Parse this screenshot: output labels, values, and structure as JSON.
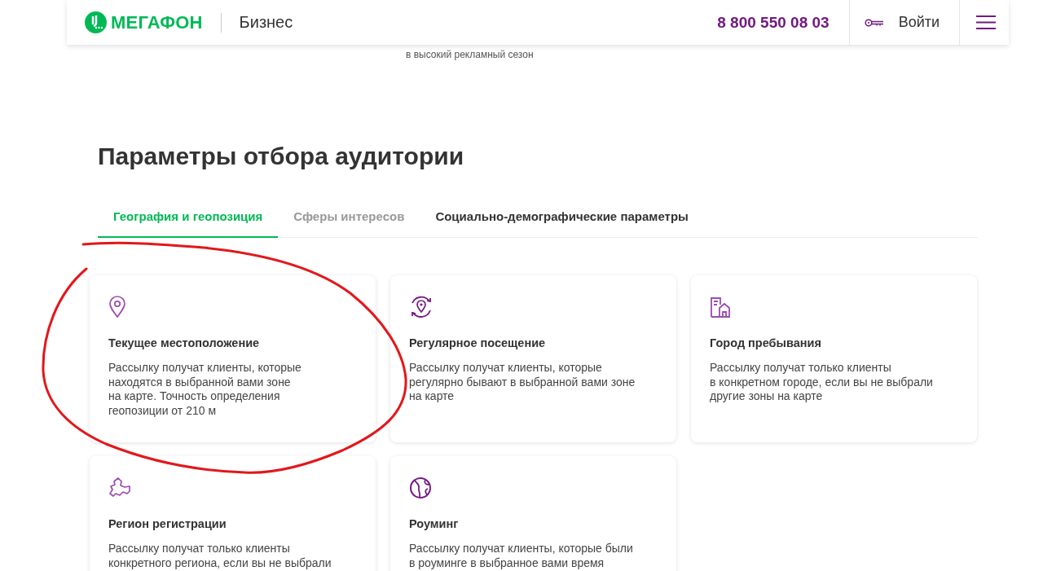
{
  "header": {
    "logo": "МЕГАФОН",
    "section": "Бизнес",
    "phone": "8 800 550 08 03",
    "login": "Войти"
  },
  "partial_text": "в высокий рекламный сезон",
  "title": "Параметры отбора аудитории",
  "tabs": [
    {
      "label": "География и геопозиция",
      "selected": true,
      "dimmed": false
    },
    {
      "label": "Сферы интересов",
      "selected": false,
      "dimmed": true
    },
    {
      "label": "Социально-демографические параметры",
      "selected": false,
      "dimmed": false
    }
  ],
  "cards": [
    {
      "kind": "pin",
      "title": "Текущее местоположение",
      "text": "Рассылку получат клиенты, которые\nнаходятся в выбранной вами зоне\nна карте. Точность определения\nгеопозиции от 210 м"
    },
    {
      "kind": "rotate-pin",
      "title": "Регулярное посещение",
      "text": "Рассылку получат клиенты, которые\nрегулярно бывают в выбранной вами зоне\nна карте"
    },
    {
      "kind": "building",
      "title": "Город пребывания",
      "text": "Рассылку получат только клиенты\nв конкретном городе, если вы не выбрали\nдругие зоны на карте"
    },
    {
      "kind": "region",
      "title": "Регион регистрации",
      "text": "Рассылку получат только клиенты\nконкретного региона, если вы не выбрали"
    },
    {
      "kind": "globe",
      "title": "Роуминг",
      "text": "Рассылку получат клиенты, которые были\nв роуминге в выбранное вами время"
    }
  ],
  "annotation": {
    "kind": "hand-drawn-circle",
    "color": "#e3171b"
  }
}
